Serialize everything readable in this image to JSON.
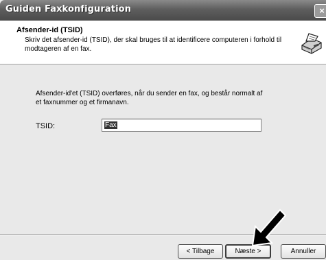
{
  "window": {
    "title": "Guiden Faxkonfiguration",
    "close_label": "×"
  },
  "header": {
    "title": "Afsender-id (TSID)",
    "description": "Skriv det afsender-id (TSID), der skal bruges til at identificere computeren i forhold til modtageren af en fax.",
    "icon": "fax-machine-icon"
  },
  "content": {
    "info_text": "Afsender-id'et (TSID) overføres, når du sender en fax, og består normalt af et faxnummer og et firmanavn.",
    "tsid_label": "TSID:",
    "tsid_value": "Fax"
  },
  "buttons": {
    "back": "< Tilbage",
    "next": "Næste >",
    "cancel": "Annuller"
  },
  "overlay": {
    "icon": "pointer-arrow-icon",
    "color": "#000000"
  }
}
